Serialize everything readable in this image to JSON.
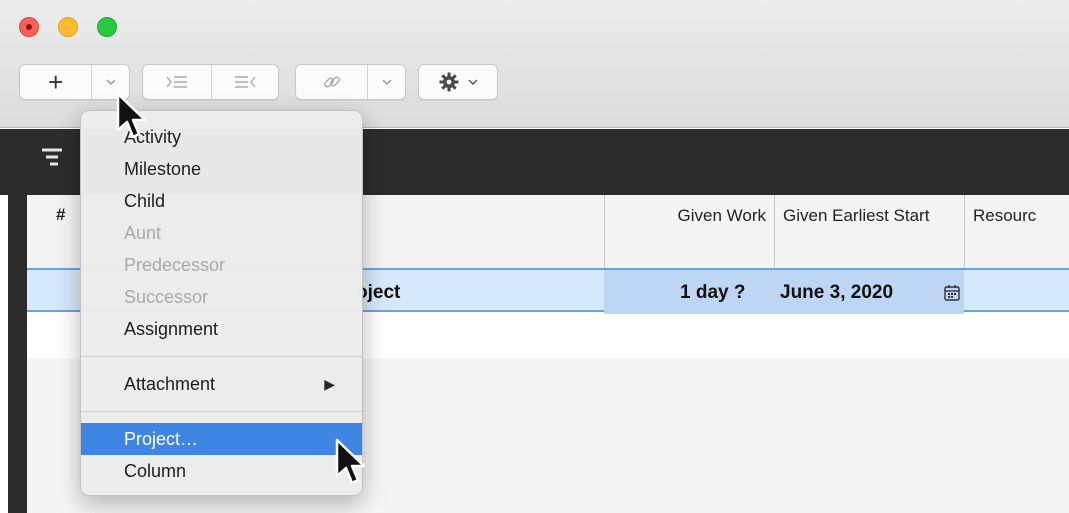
{
  "toolbar": {
    "add_label": "+",
    "icons": [
      "plus-icon",
      "chevron-down-icon",
      "indent-icon",
      "outdent-icon",
      "link-icon",
      "gear-icon"
    ]
  },
  "outline": {
    "columns": [
      "#",
      "Given Work",
      "Given Earliest Start",
      "Resourc"
    ],
    "selected_row": {
      "title_fragment": "oject",
      "given_work": "1 day ?",
      "given_earliest_start": "June 3, 2020"
    }
  },
  "menu": {
    "items": [
      {
        "label": "Activity",
        "enabled": true
      },
      {
        "label": "Milestone",
        "enabled": true
      },
      {
        "label": "Child",
        "enabled": true
      },
      {
        "label": "Aunt",
        "enabled": false
      },
      {
        "label": "Predecessor",
        "enabled": false
      },
      {
        "label": "Successor",
        "enabled": false
      },
      {
        "label": "Assignment",
        "enabled": true
      },
      {
        "label": "Attachment",
        "enabled": true,
        "submenu": true
      },
      {
        "label": "Project…",
        "enabled": true,
        "highlighted": true
      },
      {
        "label": "Column",
        "enabled": true
      }
    ],
    "submenu_arrow": "▶"
  },
  "colors": {
    "highlight": "#3f85e4",
    "selection_row": "#d6e8fb",
    "dark_band": "#2c2c2c"
  }
}
